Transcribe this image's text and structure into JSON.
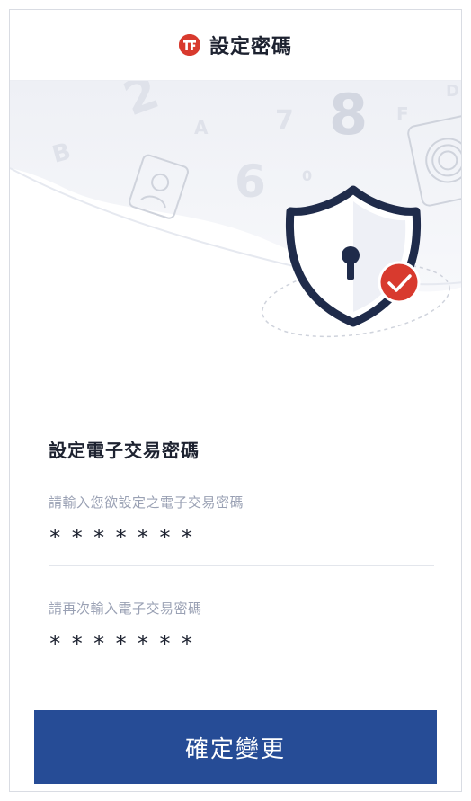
{
  "header": {
    "logo_icon": "brand-logo-icon",
    "title": "設定密碼"
  },
  "hero": {
    "illustration": "security-shield-illustration",
    "background_glyphs": [
      "8",
      "A",
      "F",
      "6",
      "0",
      "D",
      "7",
      "2",
      "B"
    ],
    "colors": {
      "shield_outline": "#1f2b4a",
      "check_badge": "#d83a2e"
    }
  },
  "form": {
    "title": "設定電子交易密碼",
    "password": {
      "label": "請輸入您欲設定之電子交易密碼",
      "value": "*******"
    },
    "confirm_password": {
      "label": "請再次輸入電子交易密碼",
      "value": "*******"
    }
  },
  "actions": {
    "confirm_label": "確定變更"
  },
  "colors": {
    "primary": "#264c96",
    "brand": "#d83a2e",
    "label": "#9aa1b4"
  }
}
